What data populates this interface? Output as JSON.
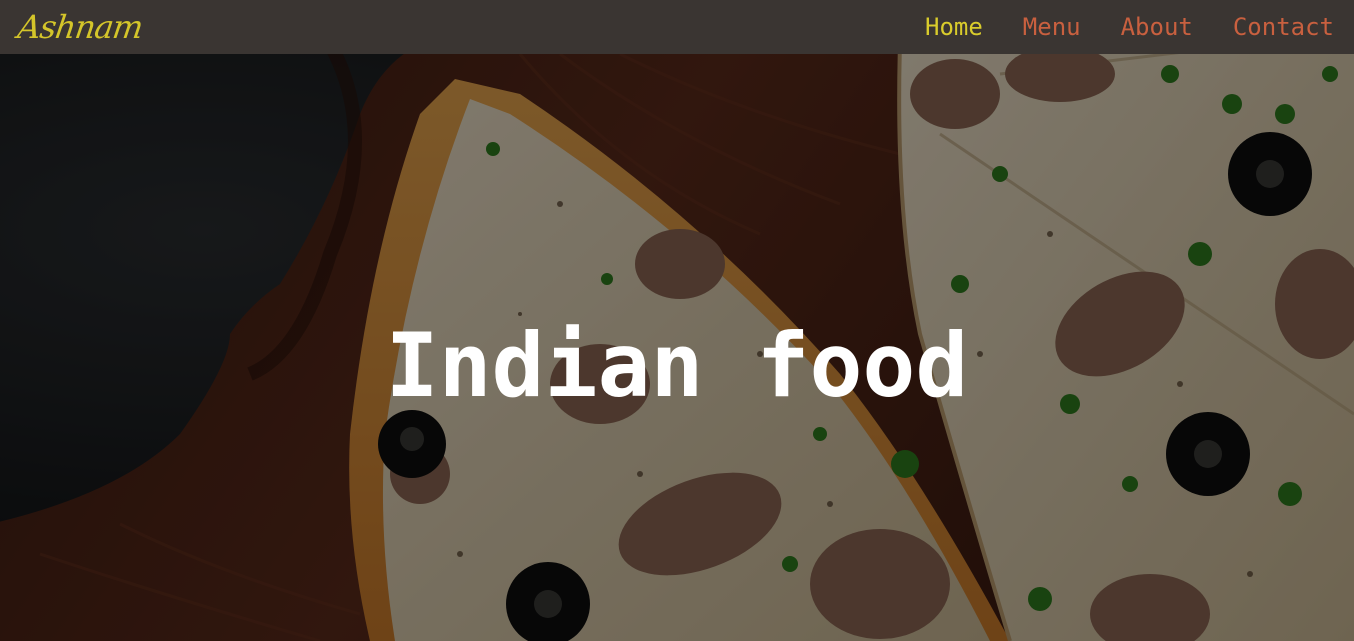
{
  "brand": {
    "logo": "Ashnam"
  },
  "nav": {
    "items": [
      {
        "label": "Home",
        "active": true
      },
      {
        "label": "Menu",
        "active": false
      },
      {
        "label": "About",
        "active": false
      },
      {
        "label": "Contact",
        "active": false
      }
    ]
  },
  "hero": {
    "title": "Indian food",
    "background": "pizza-on-wooden-board-photo"
  },
  "colors": {
    "navbar_bg": "#3a3532",
    "logo": "#d4c52a",
    "nav_active": "#d9cc2c",
    "nav_link": "#c9603f",
    "title": "#ffffff"
  }
}
